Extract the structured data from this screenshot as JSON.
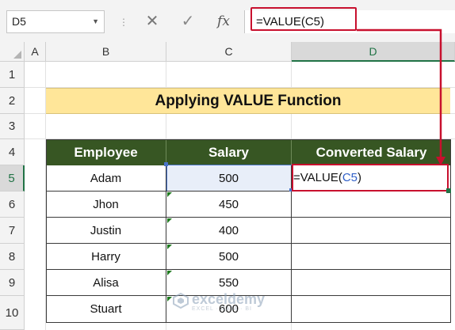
{
  "formula_bar": {
    "name_box": "D5",
    "cancel_icon": "✕",
    "enter_icon": "✓",
    "fx_label": "fx",
    "formula": "=VALUE(C5)"
  },
  "columns": [
    "A",
    "B",
    "C",
    "D"
  ],
  "rows": [
    "1",
    "2",
    "3",
    "4",
    "5",
    "6",
    "7",
    "8",
    "9",
    "10"
  ],
  "title": "Applying VALUE Function",
  "table": {
    "headers": [
      "Employee",
      "Salary",
      "Converted Salary"
    ],
    "rows": [
      {
        "employee": "Adam",
        "salary": "500",
        "converted_prefix": "=VALUE(",
        "converted_ref": "C5",
        "converted_suffix": ")"
      },
      {
        "employee": "Jhon",
        "salary": "450",
        "converted": ""
      },
      {
        "employee": "Justin",
        "salary": "400",
        "converted": ""
      },
      {
        "employee": "Harry",
        "salary": "500",
        "converted": ""
      },
      {
        "employee": "Alisa",
        "salary": "550",
        "converted": ""
      },
      {
        "employee": "Stuart",
        "salary": "600",
        "converted": ""
      }
    ]
  },
  "watermark": {
    "name": "exceldemy",
    "tagline": "EXCEL · DATA · BI"
  },
  "colors": {
    "header_green": "#375623",
    "title_yellow": "#ffe699",
    "highlight_red": "#c8102e",
    "ref_blue": "#2f5fc8"
  }
}
